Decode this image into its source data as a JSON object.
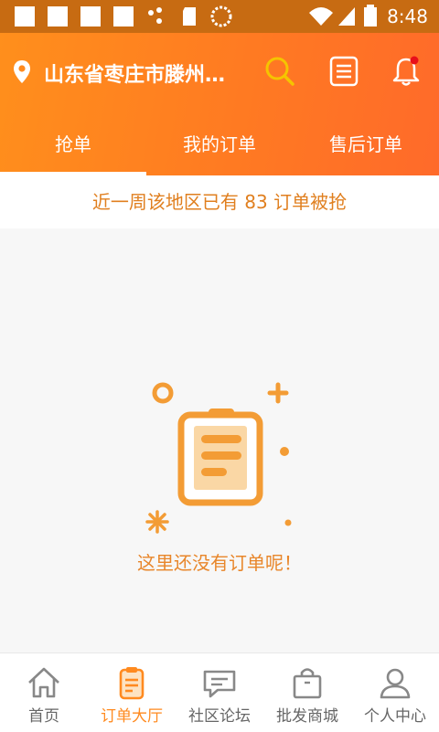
{
  "status_bar": {
    "time": "8:48"
  },
  "header": {
    "location": "山东省枣庄市滕州…",
    "icons": [
      "location-pin-icon",
      "search-icon",
      "list-icon",
      "bell-icon"
    ]
  },
  "tabs": [
    {
      "label": "抢单",
      "active": true
    },
    {
      "label": "我的订单",
      "active": false
    },
    {
      "label": "售后订单",
      "active": false
    }
  ],
  "notice": "近一周该地区已有 83 订单被抢",
  "empty_state": {
    "text": "这里还没有订单呢！",
    "icon": "clipboard-icon"
  },
  "bottom_nav": [
    {
      "label": "首页",
      "icon": "home-icon",
      "active": false
    },
    {
      "label": "订单大厅",
      "icon": "clipboard-icon",
      "active": true
    },
    {
      "label": "社区论坛",
      "icon": "chat-icon",
      "active": false
    },
    {
      "label": "批发商城",
      "icon": "shopping-bag-icon",
      "active": false
    },
    {
      "label": "个人中心",
      "icon": "user-icon",
      "active": false
    }
  ],
  "colors": {
    "accent": "#ff8a1f",
    "header_start": "#ff8f1c",
    "header_end": "#ff6a2a",
    "status_bar": "#c76b12"
  }
}
